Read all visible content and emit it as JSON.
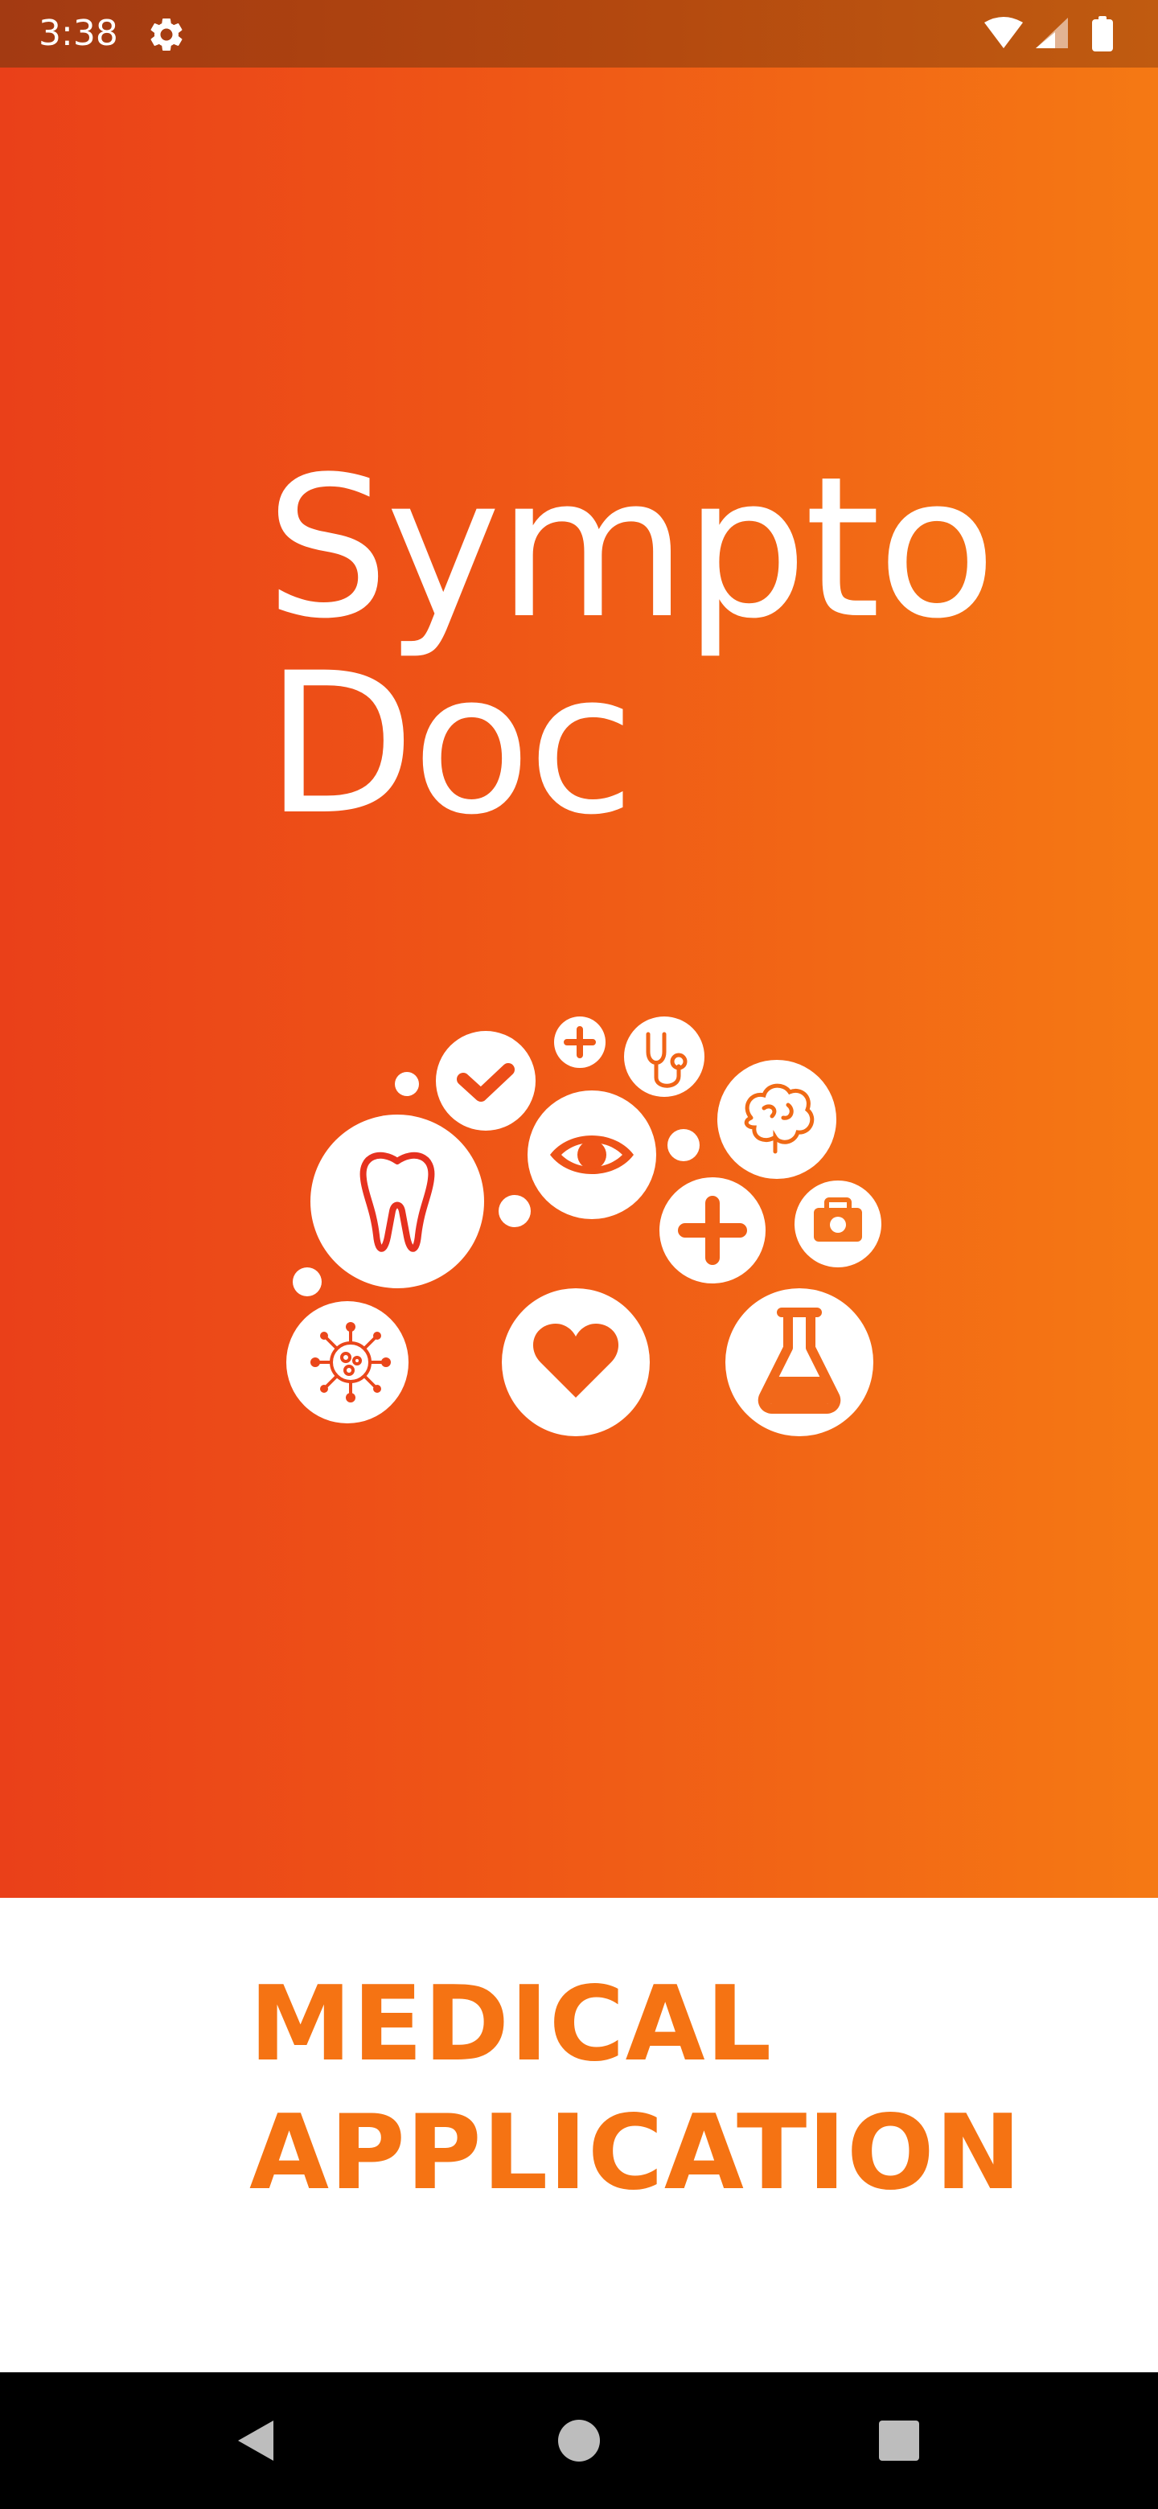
{
  "status_bar": {
    "time": "3:38",
    "icons": [
      "gear-icon",
      "wifi-icon",
      "signal-icon",
      "battery-icon"
    ]
  },
  "splash": {
    "title_line1": "Sympto",
    "title_line2": "Doc",
    "tagline_line1": "MEDICAL",
    "tagline_line2": "APPLICATION",
    "logo_icons": [
      "tooth-icon",
      "check-icon",
      "plus-icon",
      "stethoscope-icon",
      "brain-icon",
      "eye-icon",
      "medical-kit-icon",
      "virus-icon",
      "heart-icon",
      "flask-icon"
    ]
  },
  "nav_bar": {
    "buttons": [
      "back",
      "home",
      "recents"
    ]
  },
  "colors": {
    "gradient_start": "#ea4019",
    "gradient_end": "#f57914",
    "accent": "#f57313",
    "status_bar": "#b2470f",
    "nav_bar": "#000000",
    "background": "#ffffff"
  }
}
